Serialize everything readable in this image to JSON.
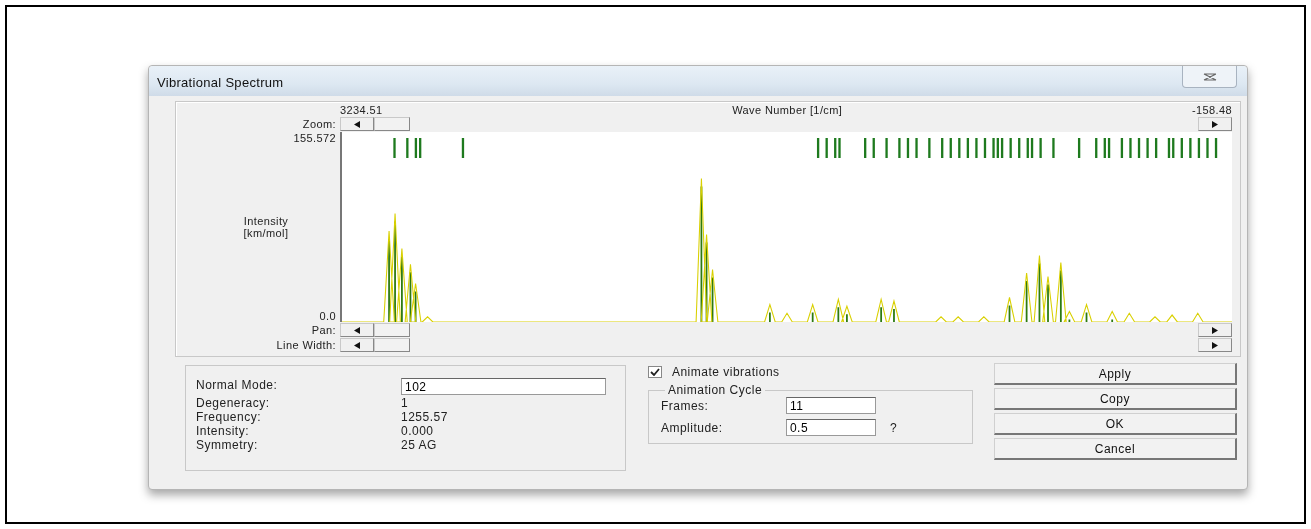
{
  "window": {
    "title": "Vibrational Spectrum"
  },
  "spectrum": {
    "x_start": "3234.51",
    "x_label": "Wave Number [1/cm]",
    "x_end": "-158.48",
    "y_max": "155.572",
    "y_label": [
      "Intensity",
      "[km/mol]"
    ],
    "y_min": "0.0"
  },
  "zoom_bar": {
    "label": "Zoom:"
  },
  "lower_bars": [
    {
      "label": "Pan:"
    },
    {
      "label": "Line Width:"
    }
  ],
  "mode_info": [
    {
      "label": "Normal Mode:",
      "value": "102",
      "kind": "field"
    },
    {
      "label": "Degeneracy:",
      "value": "1",
      "kind": "text"
    },
    {
      "label": "Frequency:",
      "value": "1255.57",
      "kind": "text"
    },
    {
      "label": "Intensity:",
      "value": "0.000",
      "kind": "text"
    },
    {
      "label": "Symmetry:",
      "value": "25 AG",
      "kind": "text"
    }
  ],
  "animate": {
    "label": "Animate vibrations",
    "checked": true
  },
  "animation_cycle": {
    "title": "Animation Cycle",
    "frames": {
      "label": "Frames:",
      "value": "11"
    },
    "amplitude": {
      "label": "Amplitude:",
      "value": "0.5"
    },
    "help": "?"
  },
  "buttons": [
    "Apply",
    "Copy",
    "OK",
    "Cancel"
  ]
}
